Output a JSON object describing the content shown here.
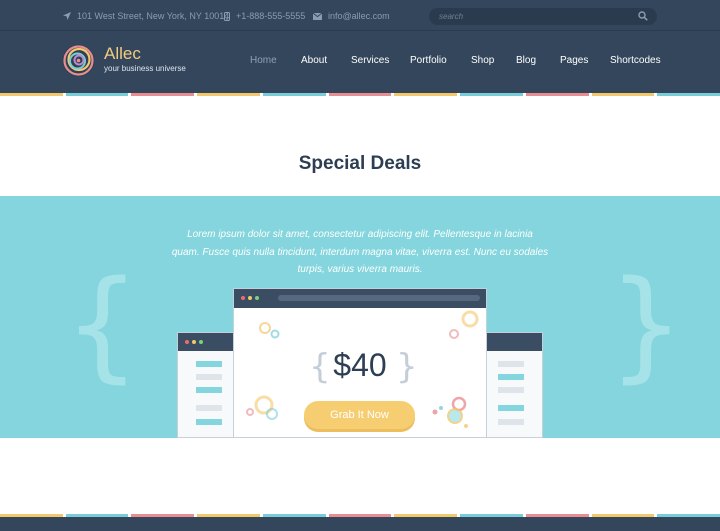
{
  "topbar": {
    "address": "101 West Street, New York, NY 10014",
    "phone": "+1-888-555-5555",
    "email": "info@allec.com",
    "search_placeholder": "search",
    "icons": [
      "location-arrow-icon",
      "phone-icon",
      "envelope-icon",
      "search-icon"
    ]
  },
  "brand": {
    "name": "Allec",
    "tagline": "your business universe"
  },
  "nav": {
    "items": [
      {
        "label": "Home",
        "active": true
      },
      {
        "label": "About",
        "active": false
      },
      {
        "label": "Services",
        "active": false
      },
      {
        "label": "Portfolio",
        "active": false
      },
      {
        "label": "Shop",
        "active": false
      },
      {
        "label": "Blog",
        "active": false
      },
      {
        "label": "Pages",
        "active": false
      },
      {
        "label": "Shortcodes",
        "active": false
      }
    ]
  },
  "deals": {
    "title": "Special Deals",
    "lorem_line1": "Lorem ipsum dolor sit amet, consectetur adipiscing elit. Pellentesque in lacinia",
    "lorem_line2": "quam. Fusce quis nulla tincidunt, interdum magna vitae, viverra est. Nunc eu sodales",
    "lorem_line3": "turpis, varius viverra mauris.",
    "price": "$40",
    "brace_open": "{",
    "brace_close": "}",
    "big_brace_open": "{",
    "big_brace_close": "}",
    "button": "Grab It Now"
  },
  "colors": {
    "navy": "#34465c",
    "teal": "#84d5dd",
    "accent_yellow": "#f7cd72",
    "stripe": [
      "#f1c86c",
      "#78cdd8",
      "#e88e93",
      "#f1c86c",
      "#78cdd8",
      "#e88e93",
      "#f1c86c",
      "#78cdd8",
      "#e88e93",
      "#f1c86c",
      "#78cdd8"
    ]
  }
}
